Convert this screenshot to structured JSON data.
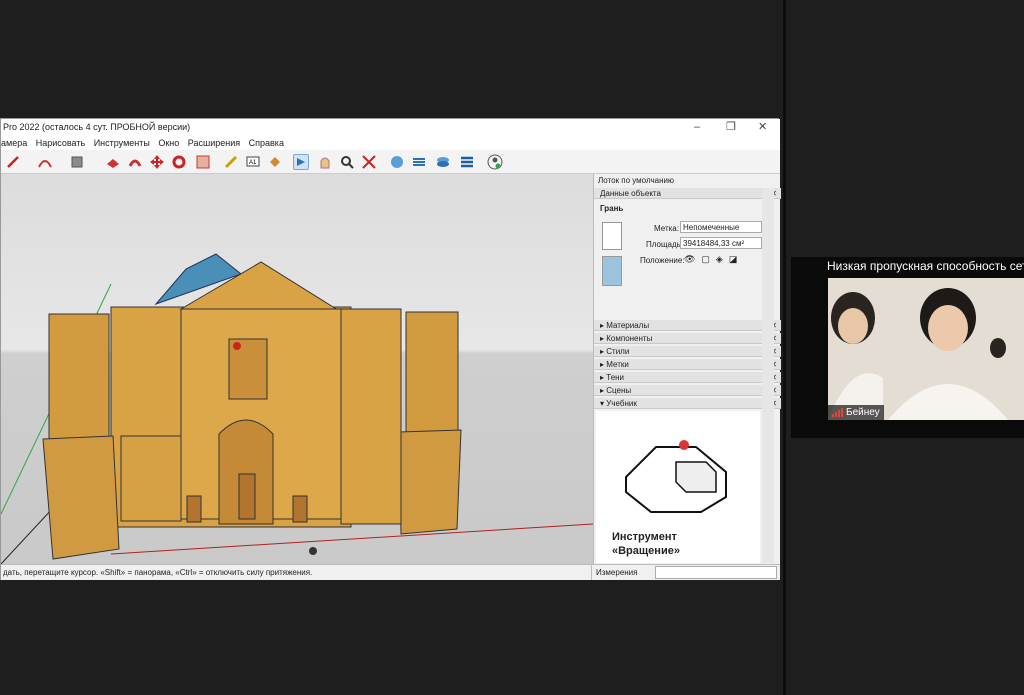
{
  "app": {
    "title": "Pro 2022 (осталось 4 сут. ПРОБНОЙ версии)",
    "window_controls": {
      "minimize": "–",
      "maximize": "❐",
      "close": "✕"
    },
    "menu": [
      "амера",
      "Нарисовать",
      "Инструменты",
      "Окно",
      "Расширения",
      "Справка"
    ],
    "toolbar_icons": [
      "pencil-icon",
      "arc-icon",
      "shape-icon",
      "push-pull-icon",
      "follow-me-icon",
      "move-icon",
      "rotate-icon",
      "scale-icon",
      "tape-measure-icon",
      "text-icon",
      "paint-bucket-icon",
      "orbit-icon",
      "pan-icon",
      "zoom-icon",
      "zoom-extents-icon",
      "warehouse-icon",
      "extension-icon",
      "layers-icon",
      "sandbox-icon",
      "user-icon"
    ],
    "status_text": "дать, перетащите курсор. «Shift» = панорама, «Ctrl» = отключить силу притяжения.",
    "measure_label": "Измерения"
  },
  "tray": {
    "title": "Лоток по умолчанию",
    "entity_panel": {
      "header": "Данные объекта",
      "type": "Грань",
      "tag_label": "Метка:",
      "tag_value": "Непомеченные",
      "area_label": "Площадь:",
      "area_value": "39418484,33 см²",
      "position_label": "Положение:"
    },
    "panels": [
      "Материалы",
      "Компоненты",
      "Стили",
      "Метки",
      "Тени",
      "Сцены",
      "Учебник"
    ],
    "tutorial": {
      "line1": "Инструмент",
      "line2": "«Вращение»"
    }
  },
  "video": {
    "caption": "Низкая пропускная способность сет",
    "participant": "Бейнеу"
  },
  "colors": {
    "facade": "#d9a244",
    "dome": "#4a8fb8",
    "signal": "#e0443a"
  }
}
